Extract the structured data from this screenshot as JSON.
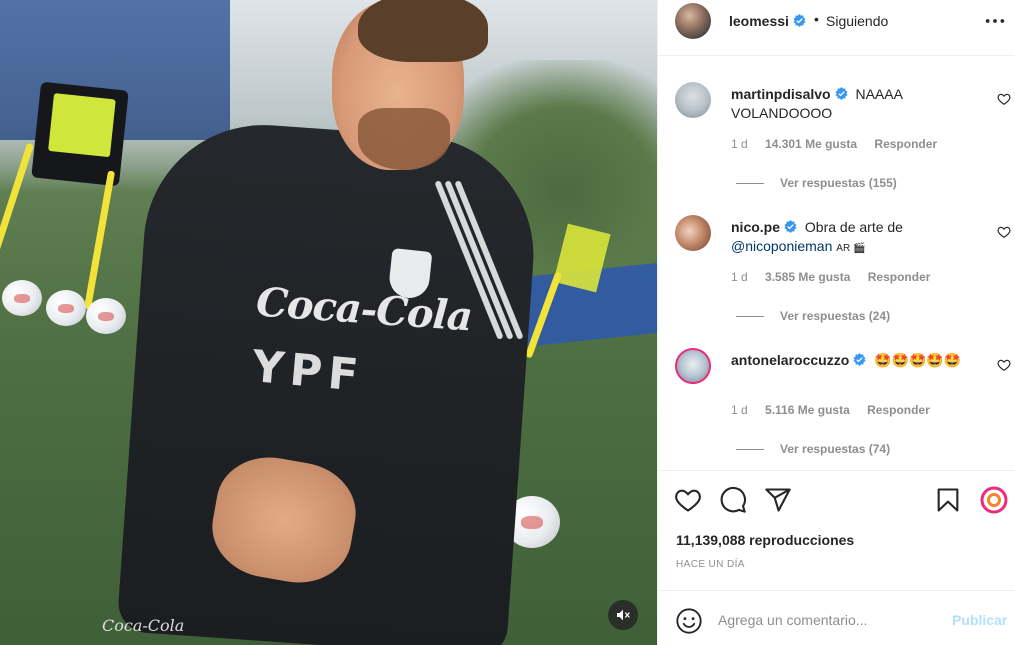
{
  "colors": {
    "verified": "#3897f0",
    "link": "#00376b",
    "muted": "#8e8e8e",
    "post_disabled": "#b2dffc",
    "story_ring": "#ee2a7b"
  },
  "media": {
    "jersey_sponsor": "Coca-Cola",
    "jersey_sponsor_2": "YPF",
    "shorts_sponsor": "Coca-Cola",
    "mute_icon": "speaker-muted-icon"
  },
  "post": {
    "author": "leomessi",
    "separator": "•",
    "follow_status": "Siguiendo",
    "more_icon": "more-horizontal-icon",
    "views": "11,139,088 reproducciones",
    "timestamp": "HACE UN DÍA"
  },
  "comments": [
    {
      "username": "martinpdisalvo",
      "verified": true,
      "text": "NAAAA VOLANDOOOO",
      "age": "1 d",
      "likes": "14.301 Me gusta",
      "reply": "Responder",
      "view_replies": "Ver respuestas (155)"
    },
    {
      "username": "nico.pe",
      "verified": true,
      "text": "Obra de arte de",
      "mention": "@nicoponieman",
      "suffix": "AR 🎬",
      "age": "1 d",
      "likes": "3.585 Me gusta",
      "reply": "Responder",
      "view_replies": "Ver respuestas (24)"
    },
    {
      "username": "antonelaroccuzzo",
      "verified": true,
      "text": "🤩🤩🤩🤩🤩",
      "age": "1 d",
      "likes": "5.116 Me gusta",
      "reply": "Responder",
      "view_replies": "Ver respuestas (74)"
    }
  ],
  "actions": {
    "like_icon": "heart-icon",
    "comment_icon": "comment-icon",
    "share_icon": "paper-plane-icon",
    "save_icon": "bookmark-icon",
    "remix_icon": "story-ring-icon"
  },
  "composer": {
    "placeholder": "Agrega un comentario...",
    "post_label": "Publicar",
    "emoji_icon": "smiley-icon"
  }
}
